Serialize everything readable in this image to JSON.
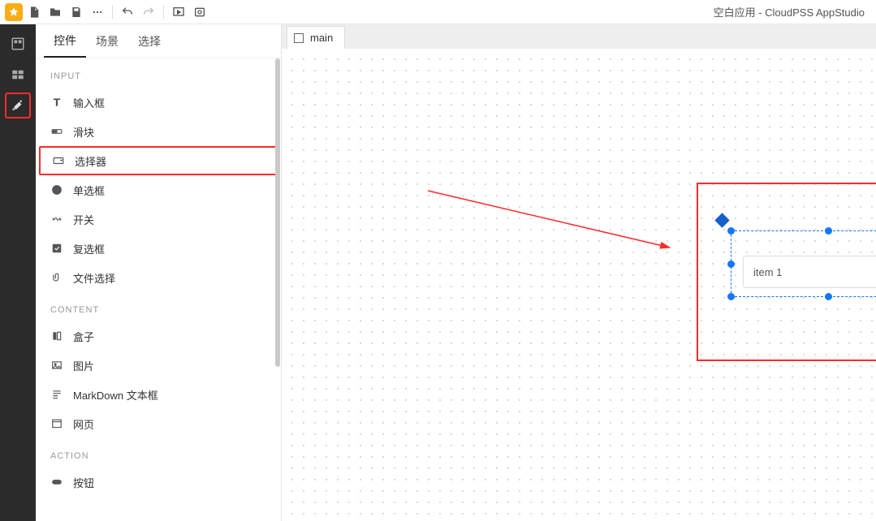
{
  "app_title": "空白应用 - CloudPSS AppStudio",
  "tabs": {
    "t0": "控件",
    "t1": "场景",
    "t2": "选择"
  },
  "section": {
    "input": "INPUT",
    "content": "CONTENT",
    "action": "ACTION"
  },
  "widgets": {
    "input_box": "输入框",
    "slider": "滑块",
    "selector": "选择器",
    "radio": "单选框",
    "switch": "开关",
    "checkbox": "复选框",
    "file": "文件选择",
    "box": "盒子",
    "image": "图片",
    "markdown": "MarkDown 文本框",
    "webpage": "网页",
    "button": "按钮"
  },
  "canvas": {
    "tab0": "main"
  },
  "component": {
    "selected_value": "item 1"
  }
}
